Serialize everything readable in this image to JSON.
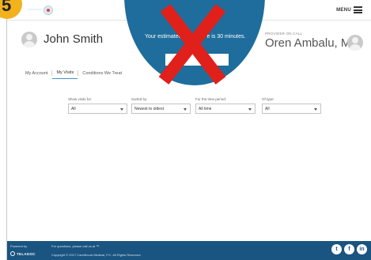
{
  "step_number": "5",
  "header": {
    "menu_label": "MENU",
    "user_name": "John Smith",
    "provider_label": "PROVIDER ON CALL",
    "provider_name": "Oren Ambalu, MD"
  },
  "wait_banner": {
    "text_start": "Your estimated",
    "text_end": "e is 30 minutes."
  },
  "tabs": [
    {
      "label": "My Account",
      "active": false
    },
    {
      "label": "My Visits",
      "active": true
    },
    {
      "label": "Conditions We Treat",
      "active": false
    }
  ],
  "filters": [
    {
      "label": "Show visits for:",
      "value": "All"
    },
    {
      "label": "Sorted by:",
      "value": "Newest to oldest"
    },
    {
      "label": "For the time period:",
      "value": "All time"
    },
    {
      "label": "Of type:",
      "value": "All"
    }
  ],
  "footer": {
    "powered_by": "Powered by",
    "teladoc": "TELADOC",
    "questions": "For questions, please call us at ™.",
    "copyright": "Copyright © 2017 CareMount Medical, P.C. All Rights Reserved."
  },
  "social": [
    {
      "icon": "twitter-icon",
      "glyph": "t"
    },
    {
      "icon": "facebook-icon",
      "glyph": "f"
    },
    {
      "icon": "linkedin-icon",
      "glyph": "in"
    }
  ],
  "colors": {
    "brand_blue": "#1e6d9c",
    "footer_blue": "#1a5480",
    "overlay_red": "#e0201a",
    "badge_yellow": "#f2b21d"
  }
}
